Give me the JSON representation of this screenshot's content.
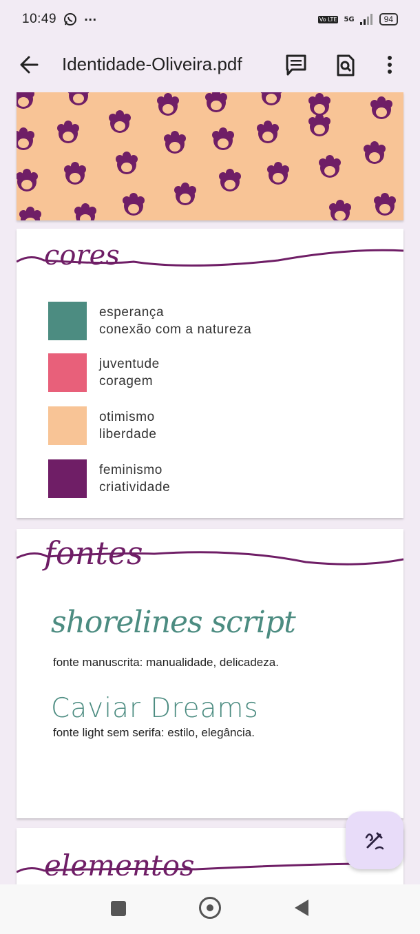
{
  "status_bar": {
    "time": "10:49",
    "network": "5G",
    "volte": "Vo LTE",
    "battery": "94"
  },
  "app_bar": {
    "title": "Identidade-Oliveira.pdf"
  },
  "icons": {
    "back": "arrow-back-icon",
    "comment": "comment-icon",
    "search_document": "find-in-page-icon",
    "more": "more-vert-icon",
    "whatsapp": "whatsapp-icon",
    "edit_fab": "draw-icon"
  },
  "colors": {
    "accent": "#6f1e66",
    "teal": "#4c8c81",
    "pattern_bg": "#f8c496"
  },
  "sections": {
    "cores": {
      "heading": "cores",
      "items": [
        {
          "color": "#4c8c81",
          "line1": "esperança",
          "line2": "conexão com a natureza"
        },
        {
          "color": "#e8607a",
          "line1": "juventude",
          "line2": "coragem"
        },
        {
          "color": "#f8c496",
          "line1": "otimismo",
          "line2": "liberdade"
        },
        {
          "color": "#6f1e66",
          "line1": "feminismo",
          "line2": "criatividade"
        }
      ]
    },
    "fontes": {
      "heading": "fontes",
      "script_sample": "shorelines script",
      "script_desc": "fonte manuscrita: manualidade, delicadeza.",
      "light_sample": "Caviar Dreams",
      "light_desc": "fonte light sem serifa: estilo, elegância."
    },
    "elementos": {
      "heading": "elementos"
    }
  }
}
